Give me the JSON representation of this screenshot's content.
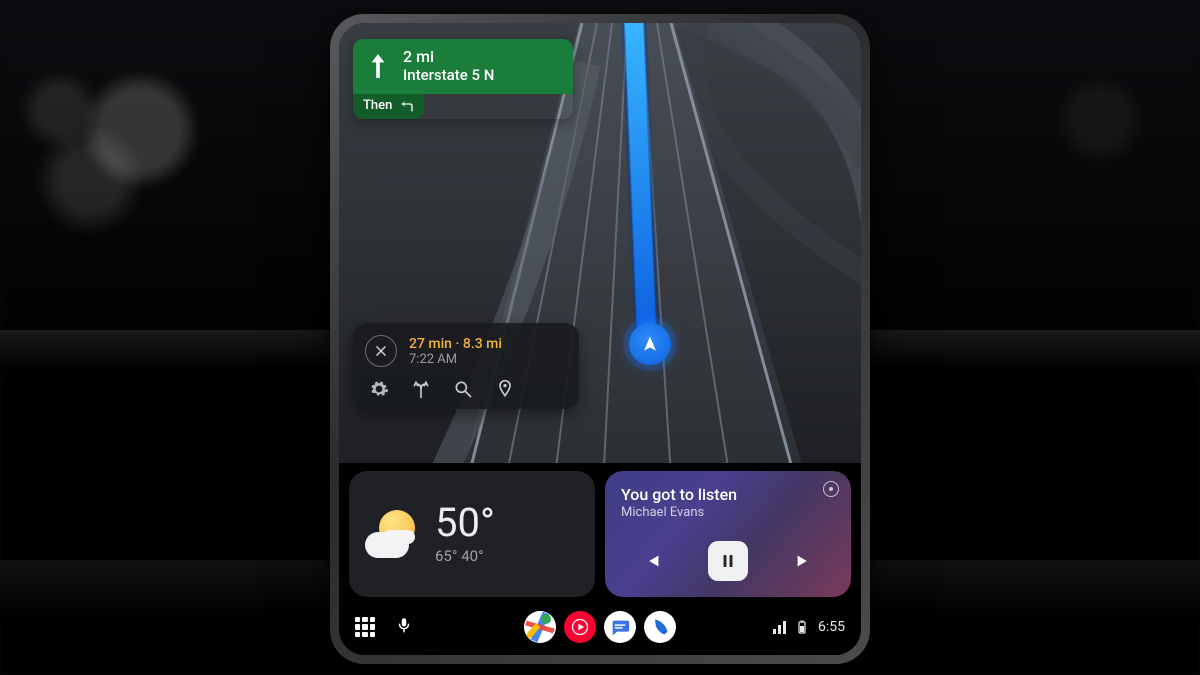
{
  "nav": {
    "distance": "2 mi",
    "road": "Interstate 5 N",
    "then_label": "Then"
  },
  "trip": {
    "close_icon": "close",
    "eta_line": "27 min · 8.3 mi",
    "arrive_time": "7:22 AM",
    "icons": {
      "settings": "gear-icon",
      "routes": "alt-route-icon",
      "search": "search-icon",
      "pin": "pin-icon"
    }
  },
  "weather": {
    "current": "50°",
    "high": "65°",
    "low": "40°"
  },
  "media": {
    "title": "You got to listen",
    "artist": "Michael Evans"
  },
  "sysbar": {
    "apps": [
      "maps",
      "youtube-music",
      "messages",
      "phone"
    ],
    "clock": "6:55"
  },
  "colors": {
    "nav_green": "#1a7d3a",
    "nav_green_dark": "#125c2a",
    "route_blue": "#1f8bff",
    "eta_amber": "#f3b33b",
    "media_purple": "#433985"
  }
}
